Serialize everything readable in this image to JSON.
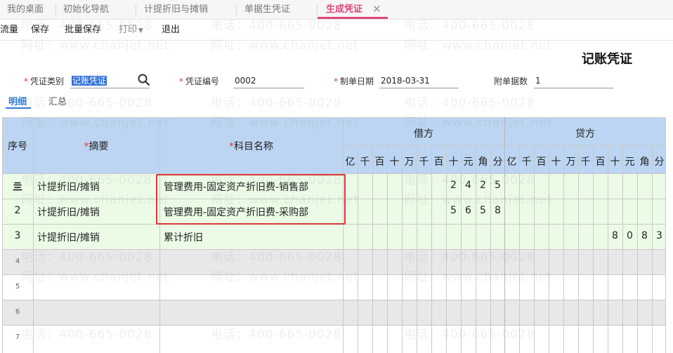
{
  "tabs": [
    {
      "label": "我的桌面"
    },
    {
      "label": "初始化导航"
    },
    {
      "label": "计提折旧与摊销"
    },
    {
      "label": "单据生凭证"
    },
    {
      "label": "生成凭证"
    }
  ],
  "tab_close": "✕",
  "toolbar": {
    "flow": "流量",
    "save": "保存",
    "batch_save": "批量保存",
    "print": "打印",
    "exit": "退出"
  },
  "doc_title": "记账凭证",
  "form": {
    "voucher_type_label": "凭证类别",
    "voucher_type_value": "记账凭证",
    "voucher_no_label": "凭证编号",
    "voucher_no_value": "0002",
    "date_label": "制单日期",
    "date_value": "2018-03-31",
    "attach_label": "附单据数",
    "attach_value": "1"
  },
  "subtabs": {
    "detail": "明细",
    "summary": "汇总"
  },
  "grid": {
    "headers": {
      "seq": "序号",
      "summary": "摘要",
      "account": "科目名称",
      "debit": "借方",
      "credit": "贷方"
    },
    "units": [
      "亿",
      "千",
      "百",
      "十",
      "万",
      "千",
      "百",
      "十",
      "元",
      "角",
      "分"
    ],
    "rows": [
      {
        "seq": "亖",
        "summary": "计提折旧/摊销",
        "account": "管理费用-固定资产折旧费-销售部",
        "debit": "2425",
        "credit": ""
      },
      {
        "seq": "2",
        "summary": "计提折旧/摊销",
        "account": "管理费用-固定资产折旧费-采购部",
        "debit": "5658",
        "credit": ""
      },
      {
        "seq": "3",
        "summary": "计提折旧/摊销",
        "account": "累计折旧",
        "debit": "",
        "credit": "8083"
      },
      {
        "seq": "4",
        "summary": "",
        "account": "",
        "debit": "",
        "credit": ""
      },
      {
        "seq": "5",
        "summary": "",
        "account": "",
        "debit": "",
        "credit": ""
      },
      {
        "seq": "6",
        "summary": "",
        "account": "",
        "debit": "",
        "credit": ""
      },
      {
        "seq": "7",
        "summary": "",
        "account": "",
        "debit": "",
        "credit": ""
      }
    ]
  },
  "watermark": {
    "phone": "电话：400-665-0028",
    "site": "网址：www.chanjet.net"
  },
  "colors": {
    "accent_tab": "#e0467c",
    "header_bg": "#bcd5f2",
    "row_green": "#ebfbe6",
    "row_gray": "#e8e8e8",
    "highlight_box": "#d83a3a",
    "link_blue": "#2f7dd8"
  }
}
